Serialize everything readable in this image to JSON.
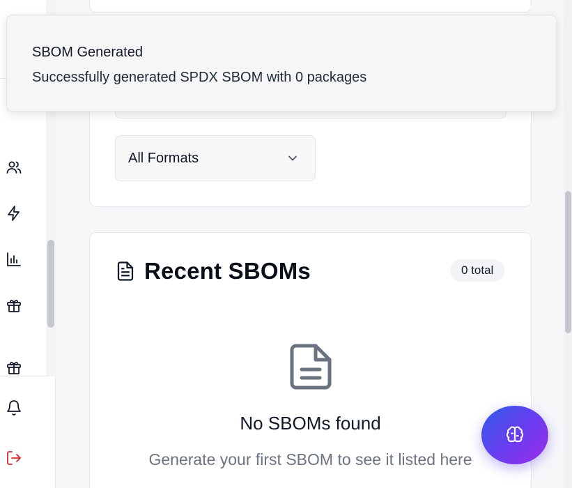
{
  "toast": {
    "title": "SBOM Generated",
    "description": "Successfully generated SPDX SBOM with 0 packages"
  },
  "filters": {
    "format_select_value": "All Formats"
  },
  "recent": {
    "title": "Recent SBOMs",
    "total_badge": "0 total",
    "empty_title": "No SBOMs found",
    "empty_subtitle": "Generate your first SBOM to see it listed here"
  },
  "sidebar": {
    "icons": [
      "users-icon",
      "lightning-icon",
      "bar-chart-icon",
      "gift-icon",
      "gift-icon",
      "bell-icon",
      "logout-icon"
    ]
  },
  "fab": {
    "icon": "brain-icon"
  },
  "colors": {
    "logout": "#dc2626",
    "fab_gradient_start": "#2f5bea",
    "fab_gradient_end": "#9a2fe6"
  }
}
